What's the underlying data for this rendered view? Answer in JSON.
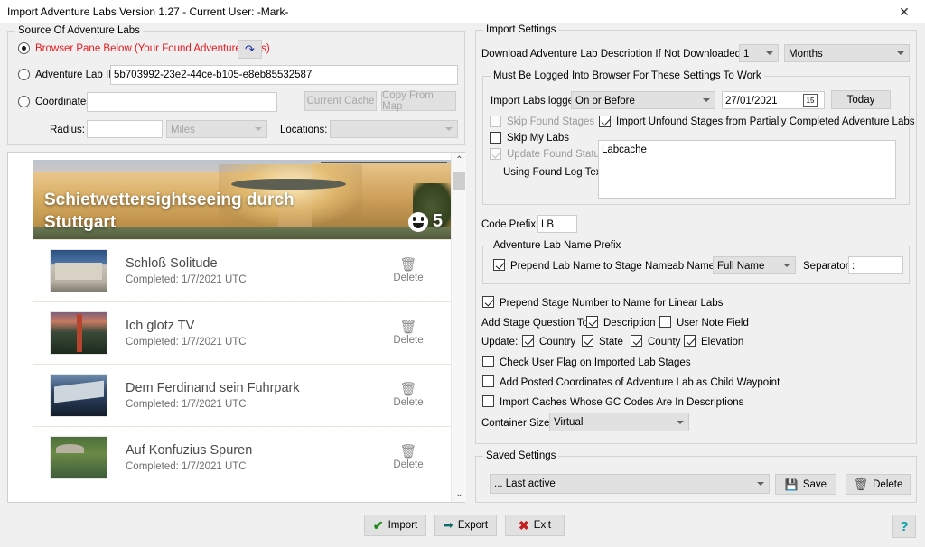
{
  "window": {
    "title": "Import Adventure Labs Version 1.27 - Current User: -Mark-",
    "close_icon": "close-icon",
    "close_glyph": "✕"
  },
  "source_group": {
    "legend": "Source Of Adventure Labs",
    "browser_pane_radio_label": "Browser Pane Below (Your Found Adventure Labs)",
    "browser_pane_radio_color": "#e8191f",
    "refresh_icon": "refresh-icon",
    "refresh_glyph": "↷",
    "lab_id_radio_label": "Adventure Lab ID:",
    "lab_id_value": "5b703992-23e2-44ce-b105-e8eb85532587",
    "coordinates_radio_label": "Coordinates:",
    "coordinates_value": "",
    "current_cache_button": "Current Cache",
    "copy_from_map_button": "Copy From Map",
    "radius_label": "Radius:",
    "radius_value": "",
    "units_value": "Miles",
    "locations_label": "Locations:",
    "locations_value": ""
  },
  "browser_pane": {
    "hero": {
      "title": "Schietwettersightseeing durch Stuttgart",
      "smiley_icon": "smiley-icon",
      "count": "5"
    },
    "delete_label": "Delete",
    "trash_icon": "trash-icon",
    "stages": [
      {
        "name": "Schloß Solitude",
        "status": "Completed: 1/7/2021 UTC",
        "thumb": "th-palace"
      },
      {
        "name": "Ich glotz TV",
        "status": "Completed: 1/7/2021 UTC",
        "thumb": "th-tower"
      },
      {
        "name": "Dem Ferdinand sein Fuhrpark",
        "status": "Completed: 1/7/2021 UTC",
        "thumb": "th-museum"
      },
      {
        "name": "Auf Konfuzius Spuren",
        "status": "Completed: 1/7/2021 UTC",
        "thumb": "th-garden"
      }
    ],
    "scroll_up_glyph": "⌃",
    "scroll_down_glyph": "⌄"
  },
  "import_settings": {
    "legend": "Import Settings",
    "download_desc_label": "Download Adventure Lab Description If Not Downloaded In Last",
    "download_desc_amount": "1",
    "download_desc_unit": "Months",
    "logged_group": {
      "legend": "Must Be Logged Into Browser For These Settings To Work",
      "import_labs_logged_label": "Import Labs logged",
      "import_labs_logged_value": "On or Before",
      "date_value": "27/01/2021",
      "calendar_icon": "calendar-icon",
      "calendar_glyph": "15",
      "today_button": "Today",
      "skip_found_stages_label": "Skip Found Stages",
      "skip_found_stages_checked": false,
      "skip_found_stages_enabled": false,
      "import_unfound_label": "Import Unfound Stages from Partially Completed Adventure Labs",
      "import_unfound_checked": true,
      "skip_my_labs_label": "Skip My Labs",
      "skip_my_labs_checked": false,
      "update_found_status_label": "Update Found Status",
      "update_found_status_checked": true,
      "update_found_status_enabled": false,
      "using_found_log_text_label": "Using Found Log Text:",
      "found_log_text_value": "Labcache"
    },
    "code_prefix_label": "Code Prefix:",
    "code_prefix_value": "LB",
    "name_prefix_group": {
      "legend": "Adventure Lab Name Prefix",
      "prepend_lab_name_label": "Prepend Lab Name to Stage Name",
      "prepend_lab_name_checked": true,
      "lab_name_label": "Lab Name:",
      "lab_name_value": "Full Name",
      "separator_label": "Separator:",
      "separator_value": ":"
    },
    "prepend_stage_number_label": "Prepend Stage Number to Name for Linear Labs",
    "prepend_stage_number_checked": true,
    "add_stage_question_label": "Add Stage Question To:",
    "description_label": "Description",
    "description_checked": true,
    "user_note_field_label": "User Note Field",
    "user_note_field_checked": false,
    "update_label": "Update:",
    "country_label": "Country",
    "country_checked": true,
    "state_label": "State",
    "state_checked": true,
    "county_label": "County",
    "county_checked": true,
    "elevation_label": "Elevation",
    "elevation_checked": true,
    "check_user_flag_label": "Check User Flag on Imported Lab Stages",
    "check_user_flag_checked": false,
    "add_posted_coords_label": "Add Posted Coordinates of Adventure Lab as Child Waypoint",
    "add_posted_coords_checked": false,
    "import_caches_gc_label": "Import Caches Whose GC Codes Are In Descriptions",
    "import_caches_gc_checked": false,
    "container_size_label": "Container Size:",
    "container_size_value": "Virtual"
  },
  "saved_settings": {
    "legend": "Saved Settings",
    "selected": "... Last active",
    "save_button": "Save",
    "save_icon": "floppy-disk-icon",
    "save_glyph": "💾",
    "delete_button": "Delete",
    "delete_icon": "trash-icon",
    "delete_glyph": "🗑"
  },
  "footer": {
    "import_button": "Import",
    "import_icon": "check-icon",
    "import_glyph": "✔",
    "export_button": "Export",
    "export_icon": "arrow-right-icon",
    "export_glyph": "➡",
    "exit_button": "Exit",
    "exit_icon": "x-icon",
    "exit_glyph": "✖",
    "help_button": "?",
    "help_icon": "question-mark-icon"
  }
}
